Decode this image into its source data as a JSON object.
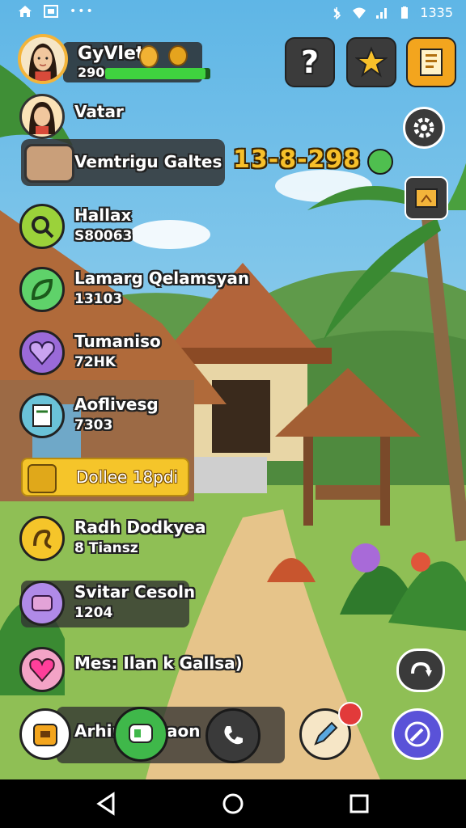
{
  "status_bar": {
    "time": "1335"
  },
  "player": {
    "name": "GyVlet",
    "xp_value": "290",
    "xp_progress": 0.95
  },
  "date_display": "13-8-298",
  "title_banner": {
    "label": "Vemtrigu Galtes"
  },
  "menu": {
    "vatar": {
      "label": "Vatar"
    },
    "hallax": {
      "label": "Hallax",
      "sub": "S80063"
    },
    "lamarg": {
      "label": "Lamarg Qelamsyan",
      "sub": "13103"
    },
    "tumaniso": {
      "label": "Tumaniso",
      "sub": "72HK"
    },
    "aoflivesg": {
      "label": "Aoflivesg",
      "sub": "7303"
    },
    "dollee": {
      "label": "Dollee 18pdi"
    },
    "radh": {
      "label": "Radh Dodkyea",
      "sub": "8 Tiansz"
    },
    "svitar": {
      "label": "Svitar Cesoln",
      "sub": "1204"
    },
    "mes": {
      "label": "Mes: Ilan k Gallsa)"
    },
    "bottom_label": "Arhin",
    "bottom_label2": "aon"
  },
  "icons": {
    "help": "question-icon",
    "favorite": "star-icon",
    "quest": "quest-book-icon",
    "settings": "gear-icon",
    "map": "map-icon",
    "sync": "refresh-icon",
    "compass": "compass-icon",
    "phone": "phone-icon",
    "chat": "chat-icon"
  },
  "colors": {
    "xp_green": "#3fd23f",
    "date_gold": "#f7c02a",
    "banner_yellow": "#f5c52a",
    "compass_purple": "#5a52d8"
  }
}
